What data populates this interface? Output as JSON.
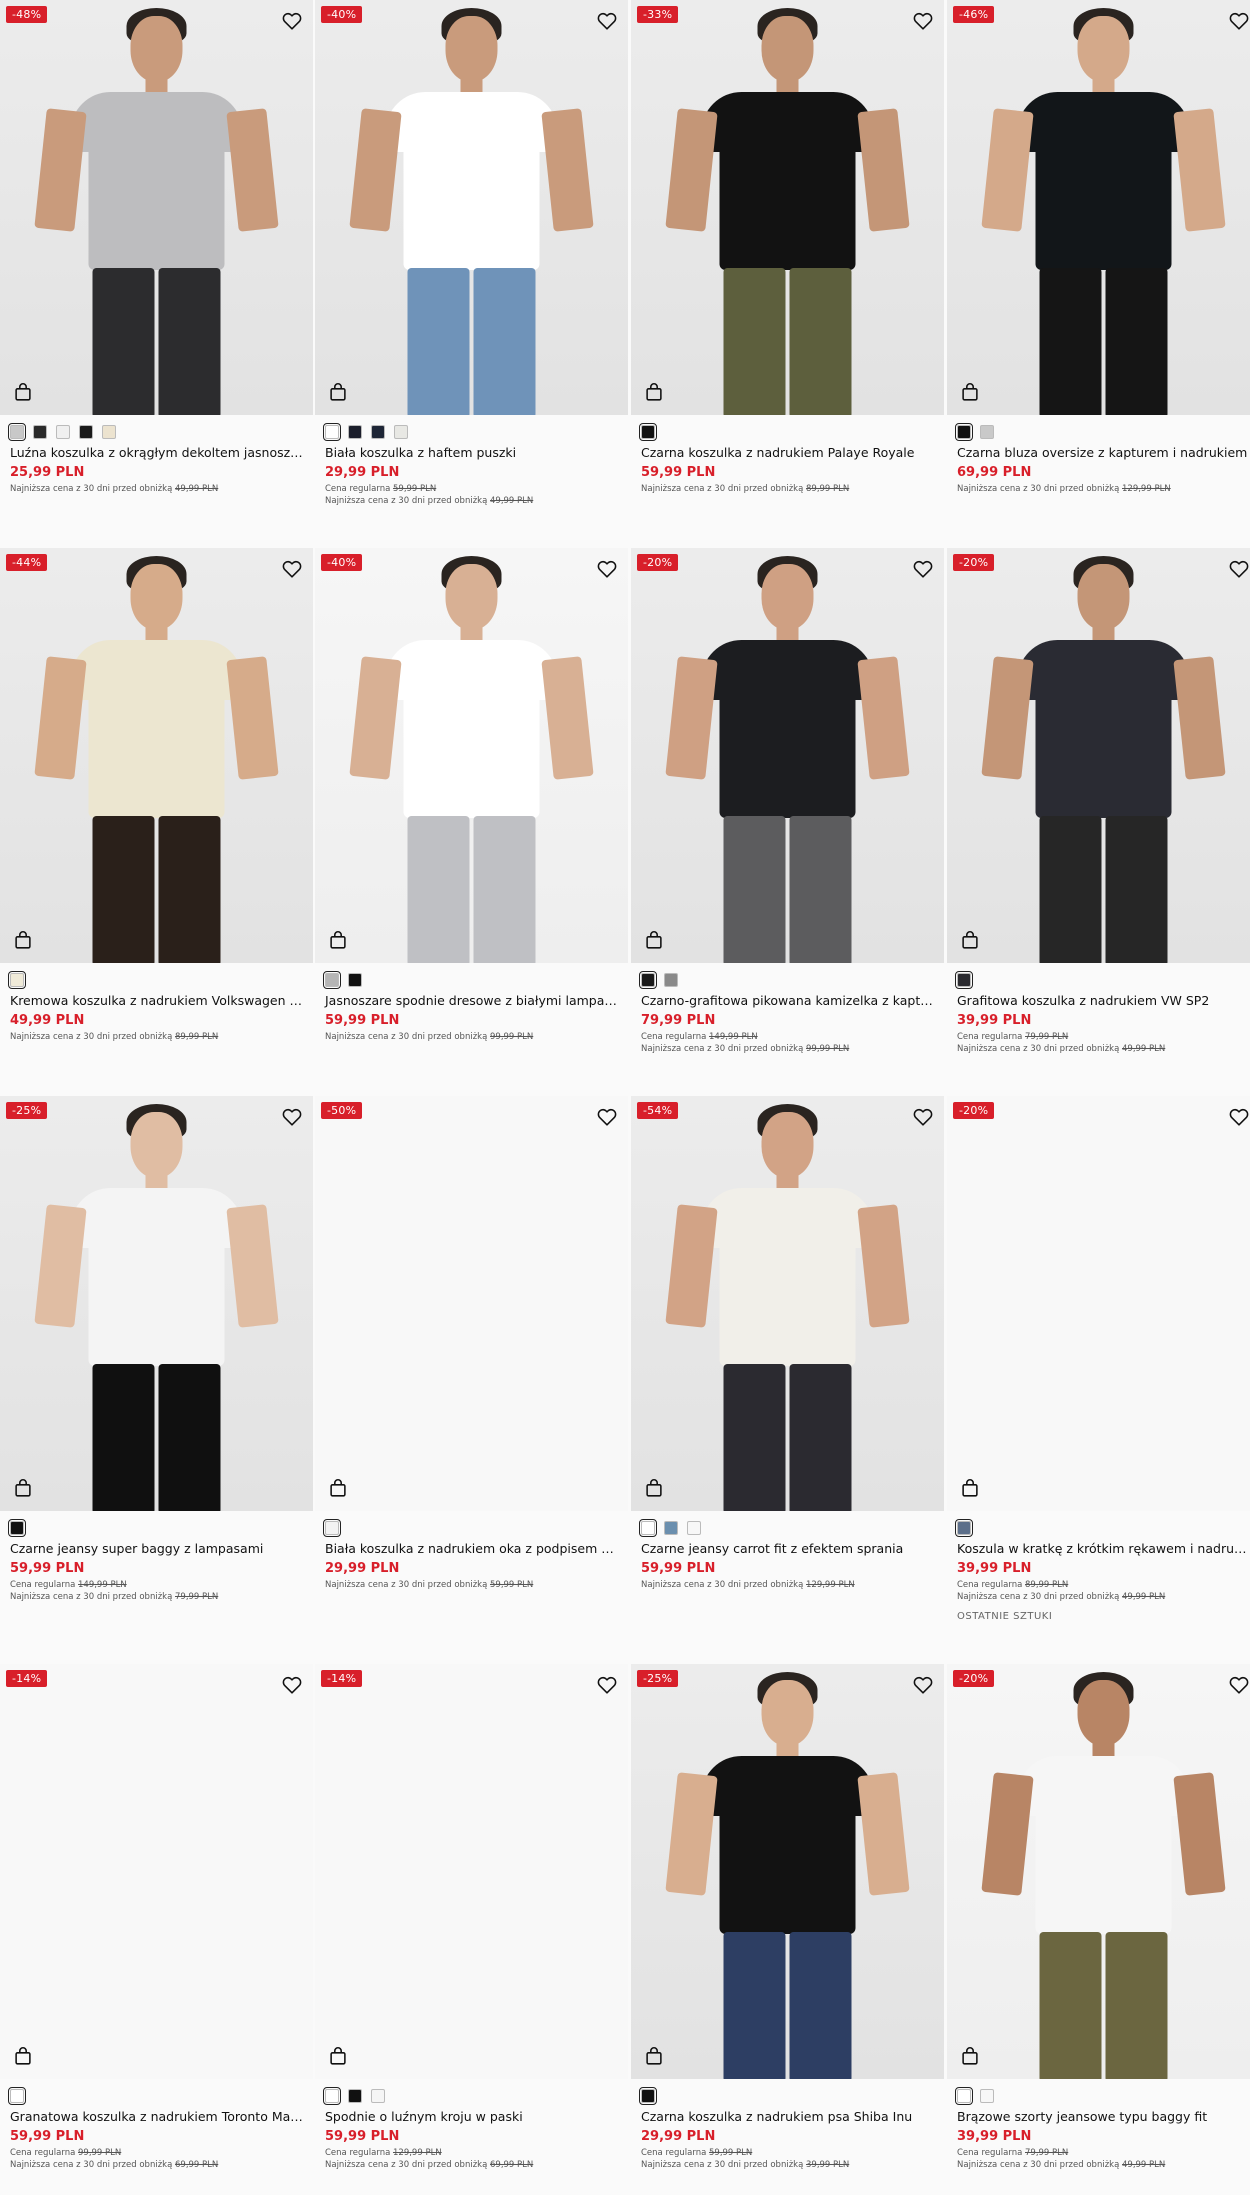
{
  "ui": {
    "currency_note_regular": "Cena regularna",
    "currency_note_lowest": "Najniższa cena z 30 dni przed obniżką"
  },
  "products": [
    {
      "badge": "-48%",
      "title": "Luźna koszulka z okrągłym dekoltem jasnoszara",
      "price": "25,99 PLN",
      "regular": "",
      "lowest": "49,99 PLN",
      "last": "",
      "swatches": [
        "#c8c8c8",
        "#2a2a2a",
        "#f0f0f0",
        "#1a1a1a",
        "#ece3cf"
      ]
    },
    {
      "badge": "-40%",
      "title": "Biała koszulka z haftem puszki",
      "price": "29,99 PLN",
      "regular": "59,99 PLN",
      "lowest": "49,99 PLN",
      "last": "",
      "swatches": [
        "#ffffff",
        "#1b1e2b",
        "#1e2636",
        "#e8e8e4"
      ]
    },
    {
      "badge": "-33%",
      "title": "Czarna koszulka z nadrukiem Palaye Royale",
      "price": "59,99 PLN",
      "regular": "",
      "lowest": "89,99 PLN",
      "last": "",
      "swatches": [
        "#111111"
      ]
    },
    {
      "badge": "-46%",
      "title": "Czarna bluza oversize z kapturem i nadrukiem",
      "price": "69,99 PLN",
      "regular": "",
      "lowest": "129,99 PLN",
      "last": "",
      "swatches": [
        "#111111",
        "#c9c9c9"
      ]
    },
    {
      "badge": "-44%",
      "title": "Kremowa koszulka z nadrukiem Volkswagen More than just",
      "price": "49,99 PLN",
      "regular": "",
      "lowest": "89,99 PLN",
      "last": "",
      "swatches": [
        "#efead8"
      ]
    },
    {
      "badge": "-40%",
      "title": "Jasnoszare spodnie dresowe z białymi lampasami",
      "price": "59,99 PLN",
      "regular": "",
      "lowest": "99,99 PLN",
      "last": "",
      "swatches": [
        "#b5b5b5",
        "#111111"
      ]
    },
    {
      "badge": "-20%",
      "title": "Czarno-grafitowa pikowana kamizelka z kapturem",
      "price": "79,99 PLN",
      "regular": "149,99 PLN",
      "lowest": "99,99 PLN",
      "last": "",
      "swatches": [
        "#1a1a1a",
        "#8a8a8a"
      ]
    },
    {
      "badge": "-20%",
      "title": "Grafitowa koszulka z nadrukiem VW SP2",
      "price": "39,99 PLN",
      "regular": "79,99 PLN",
      "lowest": "49,99 PLN",
      "last": "",
      "swatches": [
        "#2b2b30"
      ]
    },
    {
      "badge": "-25%",
      "title": "Czarne jeansy super baggy z lampasami",
      "price": "59,99 PLN",
      "regular": "149,99 PLN",
      "lowest": "79,99 PLN",
      "last": "",
      "swatches": [
        "#111111"
      ]
    },
    {
      "badge": "-50%",
      "title": "Biała koszulka z nadrukiem oka z podpisem ekipa",
      "price": "29,99 PLN",
      "regular": "",
      "lowest": "59,99 PLN",
      "last": "",
      "swatches": [
        "#f3f3f3"
      ]
    },
    {
      "badge": "-54%",
      "title": "Czarne jeansy carrot fit z efektem sprania",
      "price": "59,99 PLN",
      "regular": "",
      "lowest": "129,99 PLN",
      "last": "",
      "swatches": [
        "#ffffff",
        "#6b8fae",
        "#f7f7f7"
      ]
    },
    {
      "badge": "-20%",
      "title": "Koszula w kratkę z krótkim rękawem i nadrukiem",
      "price": "39,99 PLN",
      "regular": "89,99 PLN",
      "lowest": "49,99 PLN",
      "last": "OSTATNIE SZTUKI",
      "swatches": [
        "#5c6f8a"
      ]
    },
    {
      "badge": "-14%",
      "title": "Granatowa koszulka z nadrukiem Toronto Maple",
      "price": "59,99 PLN",
      "regular": "99,99 PLN",
      "lowest": "69,99 PLN",
      "last": "",
      "swatches": [
        "#ffffff"
      ]
    },
    {
      "badge": "-14%",
      "title": "Spodnie o luźnym kroju w paski",
      "price": "59,99 PLN",
      "regular": "129,99 PLN",
      "lowest": "69,99 PLN",
      "last": "",
      "swatches": [
        "#ffffff",
        "#111111",
        "#f5f5f5"
      ]
    },
    {
      "badge": "-25%",
      "title": "Czarna koszulka z nadrukiem psa Shiba Inu",
      "price": "29,99 PLN",
      "regular": "59,99 PLN",
      "lowest": "39,99 PLN",
      "last": "",
      "swatches": [
        "#111111"
      ]
    },
    {
      "badge": "-20%",
      "title": "Brązowe szorty jeansowe typu baggy fit",
      "price": "39,99 PLN",
      "regular": "79,99 PLN",
      "lowest": "49,99 PLN",
      "last": "",
      "swatches": [
        "#ffffff",
        "#f7f7f7"
      ]
    }
  ]
}
